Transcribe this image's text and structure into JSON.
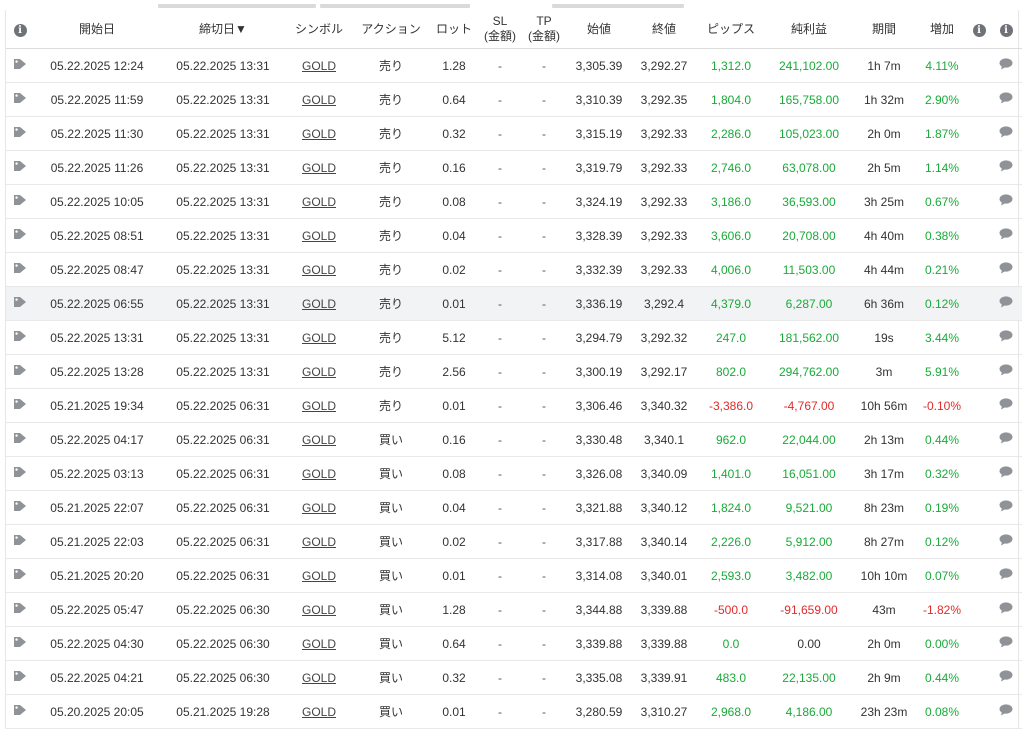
{
  "header": {
    "open_date": "開始日",
    "close_date": "締切日▼",
    "symbol": "シンボル",
    "action": "アクション",
    "lots": "ロット",
    "sl_1": "SL",
    "sl_2": "(金額)",
    "tp_1": "TP",
    "tp_2": "(金額)",
    "open_price": "始値",
    "close_price": "終値",
    "pips": "ピップス",
    "net_profit": "純利益",
    "duration": "期間",
    "gain": "増加"
  },
  "rows": [
    {
      "open": "05.22.2025 12:24",
      "close": "05.22.2025 13:31",
      "symbol": "GOLD",
      "action": "売り",
      "lots": "1.28",
      "sl": "-",
      "tp": "-",
      "open_price": "3,305.39",
      "close_price": "3,292.27",
      "pips": "1,312.0",
      "profit": "241,102.00",
      "duration": "1h 7m",
      "gain": "4.11%",
      "sign": "pos"
    },
    {
      "open": "05.22.2025 11:59",
      "close": "05.22.2025 13:31",
      "symbol": "GOLD",
      "action": "売り",
      "lots": "0.64",
      "sl": "-",
      "tp": "-",
      "open_price": "3,310.39",
      "close_price": "3,292.35",
      "pips": "1,804.0",
      "profit": "165,758.00",
      "duration": "1h 32m",
      "gain": "2.90%",
      "sign": "pos"
    },
    {
      "open": "05.22.2025 11:30",
      "close": "05.22.2025 13:31",
      "symbol": "GOLD",
      "action": "売り",
      "lots": "0.32",
      "sl": "-",
      "tp": "-",
      "open_price": "3,315.19",
      "close_price": "3,292.33",
      "pips": "2,286.0",
      "profit": "105,023.00",
      "duration": "2h 0m",
      "gain": "1.87%",
      "sign": "pos"
    },
    {
      "open": "05.22.2025 11:26",
      "close": "05.22.2025 13:31",
      "symbol": "GOLD",
      "action": "売り",
      "lots": "0.16",
      "sl": "-",
      "tp": "-",
      "open_price": "3,319.79",
      "close_price": "3,292.33",
      "pips": "2,746.0",
      "profit": "63,078.00",
      "duration": "2h 5m",
      "gain": "1.14%",
      "sign": "pos"
    },
    {
      "open": "05.22.2025 10:05",
      "close": "05.22.2025 13:31",
      "symbol": "GOLD",
      "action": "売り",
      "lots": "0.08",
      "sl": "-",
      "tp": "-",
      "open_price": "3,324.19",
      "close_price": "3,292.33",
      "pips": "3,186.0",
      "profit": "36,593.00",
      "duration": "3h 25m",
      "gain": "0.67%",
      "sign": "pos"
    },
    {
      "open": "05.22.2025 08:51",
      "close": "05.22.2025 13:31",
      "symbol": "GOLD",
      "action": "売り",
      "lots": "0.04",
      "sl": "-",
      "tp": "-",
      "open_price": "3,328.39",
      "close_price": "3,292.33",
      "pips": "3,606.0",
      "profit": "20,708.00",
      "duration": "4h 40m",
      "gain": "0.38%",
      "sign": "pos"
    },
    {
      "open": "05.22.2025 08:47",
      "close": "05.22.2025 13:31",
      "symbol": "GOLD",
      "action": "売り",
      "lots": "0.02",
      "sl": "-",
      "tp": "-",
      "open_price": "3,332.39",
      "close_price": "3,292.33",
      "pips": "4,006.0",
      "profit": "11,503.00",
      "duration": "4h 44m",
      "gain": "0.21%",
      "sign": "pos"
    },
    {
      "open": "05.22.2025 06:55",
      "close": "05.22.2025 13:31",
      "symbol": "GOLD",
      "action": "売り",
      "lots": "0.01",
      "sl": "-",
      "tp": "-",
      "open_price": "3,336.19",
      "close_price": "3,292.4",
      "pips": "4,379.0",
      "profit": "6,287.00",
      "duration": "6h 36m",
      "gain": "0.12%",
      "sign": "pos",
      "highlight": true
    },
    {
      "open": "05.22.2025 13:31",
      "close": "05.22.2025 13:31",
      "symbol": "GOLD",
      "action": "売り",
      "lots": "5.12",
      "sl": "-",
      "tp": "-",
      "open_price": "3,294.79",
      "close_price": "3,292.32",
      "pips": "247.0",
      "profit": "181,562.00",
      "duration": "19s",
      "gain": "3.44%",
      "sign": "pos"
    },
    {
      "open": "05.22.2025 13:28",
      "close": "05.22.2025 13:31",
      "symbol": "GOLD",
      "action": "売り",
      "lots": "2.56",
      "sl": "-",
      "tp": "-",
      "open_price": "3,300.19",
      "close_price": "3,292.17",
      "pips": "802.0",
      "profit": "294,762.00",
      "duration": "3m",
      "gain": "5.91%",
      "sign": "pos"
    },
    {
      "open": "05.21.2025 19:34",
      "close": "05.22.2025 06:31",
      "symbol": "GOLD",
      "action": "売り",
      "lots": "0.01",
      "sl": "-",
      "tp": "-",
      "open_price": "3,306.46",
      "close_price": "3,340.32",
      "pips": "-3,386.0",
      "profit": "-4,767.00",
      "duration": "10h 56m",
      "gain": "-0.10%",
      "sign": "neg"
    },
    {
      "open": "05.22.2025 04:17",
      "close": "05.22.2025 06:31",
      "symbol": "GOLD",
      "action": "買い",
      "lots": "0.16",
      "sl": "-",
      "tp": "-",
      "open_price": "3,330.48",
      "close_price": "3,340.1",
      "pips": "962.0",
      "profit": "22,044.00",
      "duration": "2h 13m",
      "gain": "0.44%",
      "sign": "pos"
    },
    {
      "open": "05.22.2025 03:13",
      "close": "05.22.2025 06:31",
      "symbol": "GOLD",
      "action": "買い",
      "lots": "0.08",
      "sl": "-",
      "tp": "-",
      "open_price": "3,326.08",
      "close_price": "3,340.09",
      "pips": "1,401.0",
      "profit": "16,051.00",
      "duration": "3h 17m",
      "gain": "0.32%",
      "sign": "pos"
    },
    {
      "open": "05.21.2025 22:07",
      "close": "05.22.2025 06:31",
      "symbol": "GOLD",
      "action": "買い",
      "lots": "0.04",
      "sl": "-",
      "tp": "-",
      "open_price": "3,321.88",
      "close_price": "3,340.12",
      "pips": "1,824.0",
      "profit": "9,521.00",
      "duration": "8h 23m",
      "gain": "0.19%",
      "sign": "pos"
    },
    {
      "open": "05.21.2025 22:03",
      "close": "05.22.2025 06:31",
      "symbol": "GOLD",
      "action": "買い",
      "lots": "0.02",
      "sl": "-",
      "tp": "-",
      "open_price": "3,317.88",
      "close_price": "3,340.14",
      "pips": "2,226.0",
      "profit": "5,912.00",
      "duration": "8h 27m",
      "gain": "0.12%",
      "sign": "pos"
    },
    {
      "open": "05.21.2025 20:20",
      "close": "05.22.2025 06:31",
      "symbol": "GOLD",
      "action": "買い",
      "lots": "0.01",
      "sl": "-",
      "tp": "-",
      "open_price": "3,314.08",
      "close_price": "3,340.01",
      "pips": "2,593.0",
      "profit": "3,482.00",
      "duration": "10h 10m",
      "gain": "0.07%",
      "sign": "pos"
    },
    {
      "open": "05.22.2025 05:47",
      "close": "05.22.2025 06:30",
      "symbol": "GOLD",
      "action": "買い",
      "lots": "1.28",
      "sl": "-",
      "tp": "-",
      "open_price": "3,344.88",
      "close_price": "3,339.88",
      "pips": "-500.0",
      "profit": "-91,659.00",
      "duration": "43m",
      "gain": "-1.82%",
      "sign": "neg"
    },
    {
      "open": "05.22.2025 04:30",
      "close": "05.22.2025 06:30",
      "symbol": "GOLD",
      "action": "買い",
      "lots": "0.64",
      "sl": "-",
      "tp": "-",
      "open_price": "3,339.88",
      "close_price": "3,339.88",
      "pips": "0.0",
      "profit": "0.00",
      "duration": "2h 0m",
      "gain": "0.00%",
      "sign": "zero"
    },
    {
      "open": "05.22.2025 04:21",
      "close": "05.22.2025 06:30",
      "symbol": "GOLD",
      "action": "買い",
      "lots": "0.32",
      "sl": "-",
      "tp": "-",
      "open_price": "3,335.08",
      "close_price": "3,339.91",
      "pips": "483.0",
      "profit": "22,135.00",
      "duration": "2h 9m",
      "gain": "0.44%",
      "sign": "pos"
    },
    {
      "open": "05.20.2025 20:05",
      "close": "05.21.2025 19:28",
      "symbol": "GOLD",
      "action": "買い",
      "lots": "0.01",
      "sl": "-",
      "tp": "-",
      "open_price": "3,280.59",
      "close_price": "3,310.27",
      "pips": "2,968.0",
      "profit": "4,186.00",
      "duration": "23h 23m",
      "gain": "0.08%",
      "sign": "pos"
    }
  ],
  "colors": {
    "positive": "#1aaa3a",
    "negative": "#e02b2b",
    "icon": "#8f9397",
    "highlight_row": "#f2f3f5"
  },
  "icons": {
    "row_leading": "tag-icon",
    "row_trailing": "chat-icon",
    "header_info": "info-icon"
  }
}
